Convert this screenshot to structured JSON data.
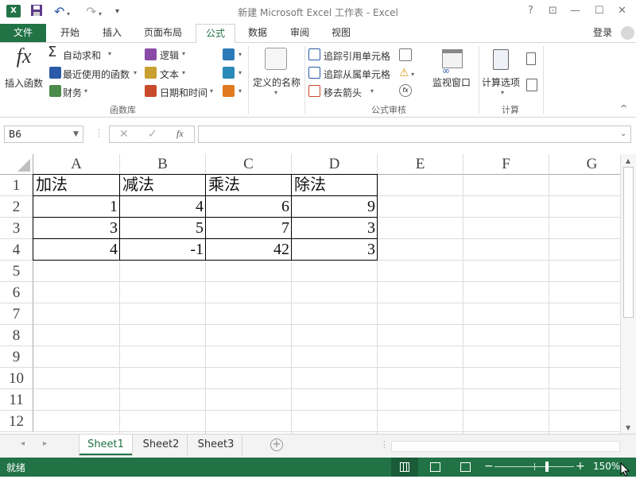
{
  "titlebar": {
    "title": "新建 Microsoft Excel 工作表 - Excel",
    "help": "?",
    "restore_ribbon": "⊡",
    "minimize": "—",
    "maximize": "☐",
    "close": "✕"
  },
  "tabs": {
    "file": "文件",
    "items": [
      "开始",
      "插入",
      "页面布局",
      "公式",
      "数据",
      "审阅",
      "视图"
    ],
    "login": "登录"
  },
  "ribbon": {
    "insert_function": "插入函数",
    "autosum": "自动求和",
    "recent": "最近使用的函数",
    "finance": "财务",
    "logic": "逻辑",
    "text": "文本",
    "datetime": "日期和时间",
    "define_name": "定义的名称",
    "trace_precedents": "追踪引用单元格",
    "trace_dependents": "追踪从属单元格",
    "remove_arrows": "移去箭头",
    "watch_window": "监视窗口",
    "calc_options": "计算选项",
    "group_library": "函数库",
    "group_audit": "公式审核",
    "group_calc": "计算",
    "fx_glyph": "fx"
  },
  "formula_bar": {
    "name_box": "B6",
    "cancel": "✕",
    "enter": "✓",
    "fx": "fx",
    "value": ""
  },
  "sheet": {
    "columns": [
      "A",
      "B",
      "C",
      "D",
      "E",
      "F",
      "G"
    ],
    "rows": [
      "1",
      "2",
      "3",
      "4",
      "5",
      "6",
      "7",
      "8",
      "9",
      "10",
      "11",
      "12"
    ],
    "data": [
      [
        "加法",
        "减法",
        "乘法",
        "除法"
      ],
      [
        "1",
        "4",
        "6",
        "9"
      ],
      [
        "3",
        "5",
        "7",
        "3"
      ],
      [
        "4",
        "-1",
        "42",
        "3"
      ]
    ]
  },
  "sheet_tabs": [
    "Sheet1",
    "Sheet2",
    "Sheet3"
  ],
  "status": {
    "ready": "就绪",
    "zoom": "150%",
    "zoom_fraction": 0.66
  },
  "colors": {
    "accent": "#217346"
  }
}
